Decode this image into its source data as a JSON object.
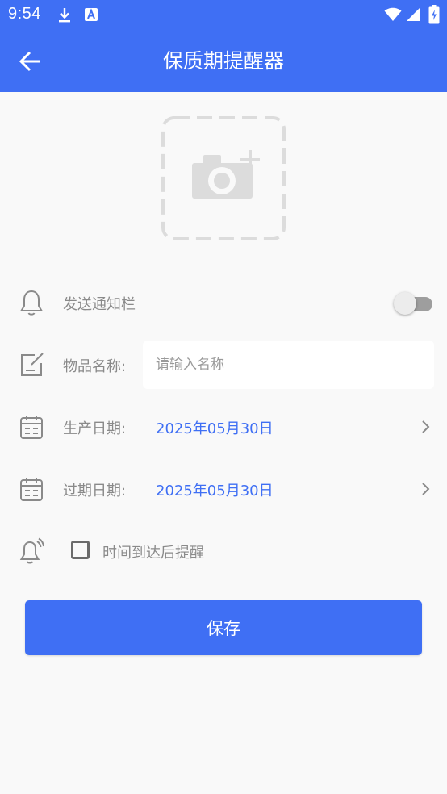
{
  "status_bar": {
    "time": "9:54",
    "icons": [
      "download-icon",
      "a-text-icon",
      "wifi-icon",
      "signal-icon",
      "battery-charging-icon"
    ]
  },
  "app_bar": {
    "title": "保质期提醒器",
    "back_icon": "arrow-left-icon"
  },
  "photo": {
    "icon": "camera-add-icon"
  },
  "notify_row": {
    "icon": "bell-icon",
    "label": "发送通知栏",
    "enabled": false
  },
  "name_row": {
    "icon": "edit-icon",
    "label": "物品名称:",
    "value": "",
    "placeholder": "请输入名称"
  },
  "production_row": {
    "icon": "calendar-icon",
    "label": "生产日期:",
    "value": "2025年05月30日"
  },
  "expiry_row": {
    "icon": "calendar-icon",
    "label": "过期日期:",
    "value": "2025年05月30日"
  },
  "remind_row": {
    "icon": "bell-ringing-icon",
    "label": "时间到达后提醒",
    "checked": false
  },
  "save_button": {
    "label": "保存"
  },
  "colors": {
    "primary": "#3f6ff4",
    "background": "#f9f9f9",
    "label": "#8a8a8a"
  }
}
